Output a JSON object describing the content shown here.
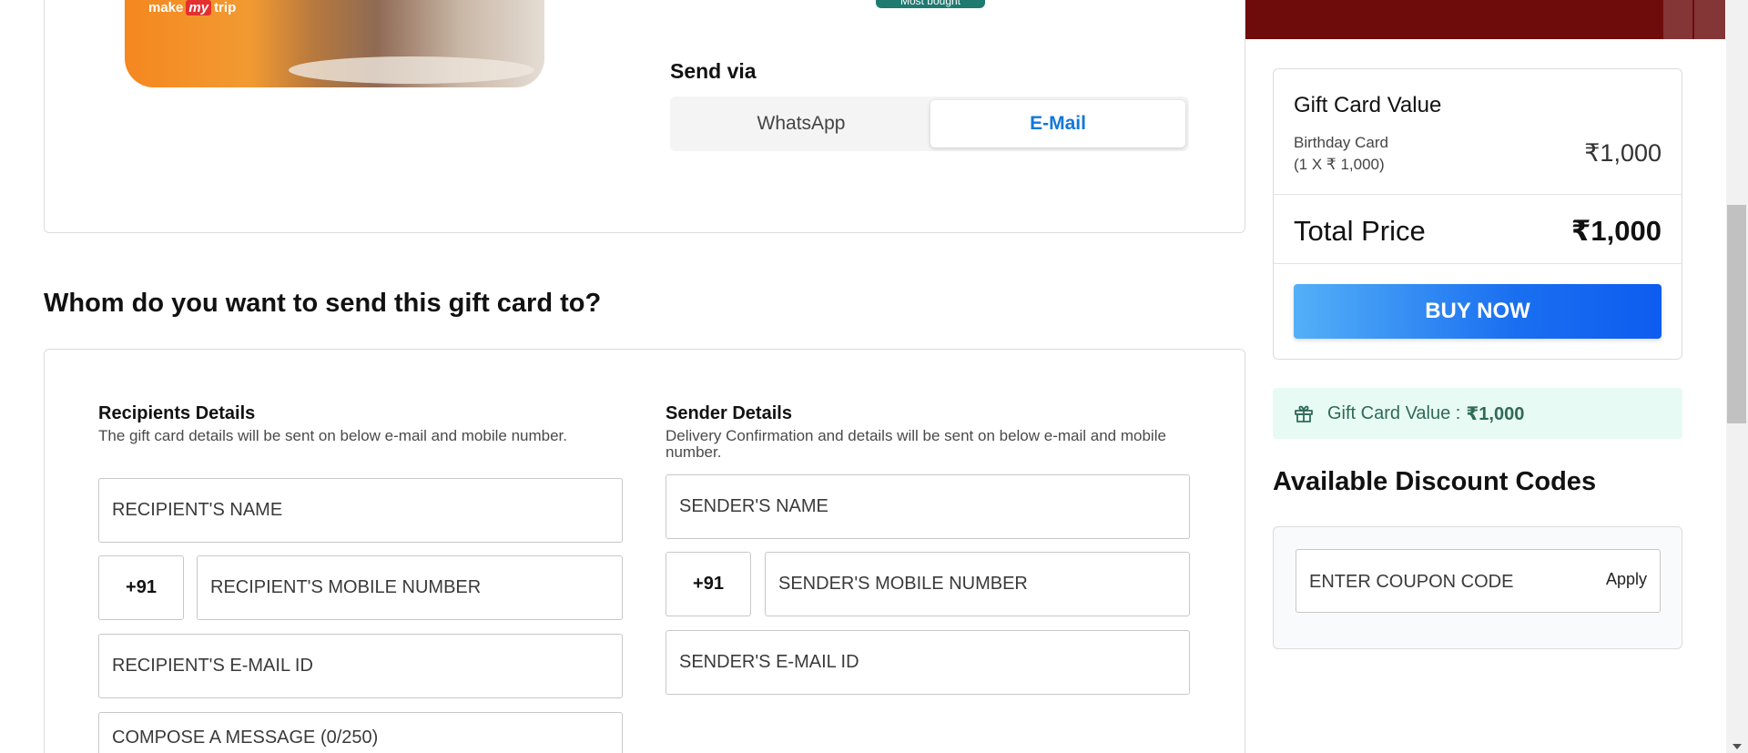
{
  "gift_card": {
    "brand_logo_text_left": "make",
    "brand_logo_text_mid": "my",
    "brand_logo_text_right": "trip",
    "badge": "Most bought"
  },
  "send_via": {
    "label": "Send via",
    "options": [
      "WhatsApp",
      "E-Mail"
    ],
    "selected": "E-Mail"
  },
  "recipient_section": {
    "heading": "Whom do you want to send this gift card to?"
  },
  "recipients": {
    "title": "Recipients Details",
    "subtitle": "The gift card details will be sent on below e-mail and mobile number.",
    "name_placeholder": "RECIPIENT'S NAME",
    "country_code": "+91",
    "mobile_placeholder": "RECIPIENT'S MOBILE NUMBER",
    "email_placeholder": "RECIPIENT'S E-MAIL ID",
    "message_placeholder": "COMPOSE A MESSAGE (0/250)"
  },
  "sender": {
    "title": "Sender Details",
    "subtitle": "Delivery Confirmation and details will be sent on below e-mail and mobile number.",
    "name_placeholder": "SENDER'S NAME",
    "country_code": "+91",
    "mobile_placeholder": "SENDER'S MOBILE NUMBER",
    "email_placeholder": "SENDER'S E-MAIL ID"
  },
  "summary": {
    "title": "Gift Card Value",
    "item_name": "Birthday Card",
    "item_detail": "(1 X ₹ 1,000)",
    "item_value": "₹1,000",
    "total_label": "Total Price",
    "total_value": "₹1,000",
    "buy_button": "BUY NOW"
  },
  "gift_value_strip": {
    "label": "Gift Card Value :",
    "value": "₹1,000"
  },
  "discount": {
    "title": "Available Discount Codes",
    "coupon_placeholder": "ENTER COUPON CODE",
    "apply_label": "Apply"
  },
  "colors": {
    "header_band": "#6e0c0c",
    "email_accent": "#1178d9",
    "buy_gradient_start": "#53b0f7",
    "buy_gradient_end": "#0e5cf0",
    "gift_strip_bg": "#e8faf4",
    "most_bought_badge": "#1f7a70"
  }
}
